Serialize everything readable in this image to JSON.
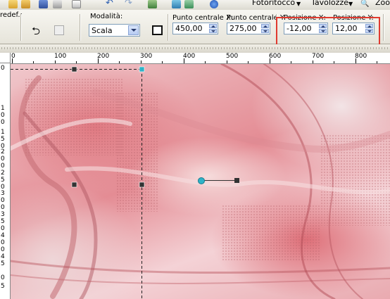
{
  "menu": {
    "fotoritocco": "Fotoritocco",
    "tavolozze": "Tavolozze",
    "zoom": "Zoo"
  },
  "toolbar": {
    "predef_label": "redef.:",
    "modalita_label": "Modalità:",
    "modalita_value": "Scala",
    "centro_x_label": "Punto centrale X:",
    "centro_x_value": "450,00",
    "centro_y_label": "Punto centrale Y:",
    "centro_y_value": "275,00",
    "pos_x_label": "Posizione X:",
    "pos_x_value": "-12,00",
    "pos_y_label": "Posizione Y:",
    "pos_y_value": "12,00"
  },
  "ruler": {
    "h_ticks": [
      "0",
      "100",
      "200",
      "300",
      "400",
      "500",
      "600",
      "700",
      "800"
    ],
    "v_ticks": [
      "0",
      "1",
      "0",
      "0",
      "1",
      "5",
      "0",
      "2",
      "0",
      "0",
      "2",
      "5",
      "0",
      "3",
      "0",
      "0",
      "3",
      "5",
      "0",
      "4",
      "0",
      "0",
      "4",
      "5",
      "0",
      "5"
    ]
  },
  "colors": {
    "highlight": "#e03a30",
    "accent": "#2a3d6e",
    "canvas_pink": "#e48c94"
  }
}
